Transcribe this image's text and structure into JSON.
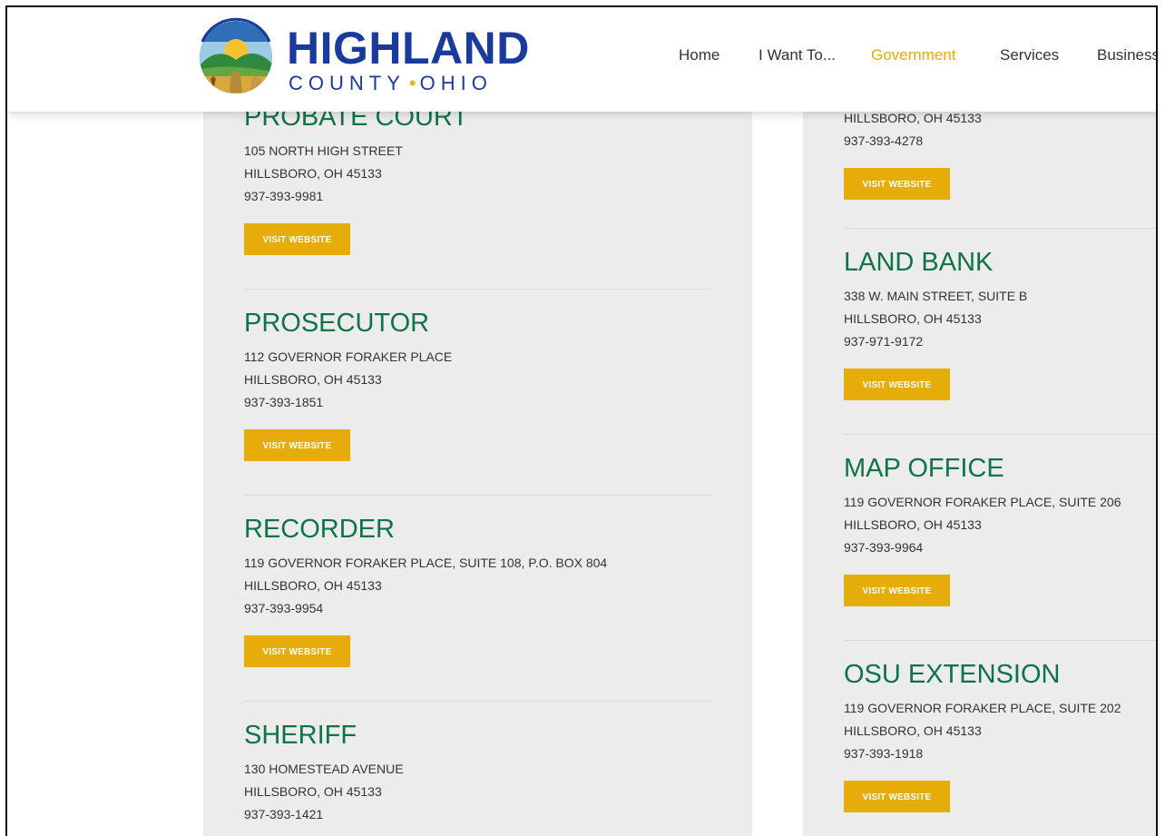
{
  "header": {
    "brand_main": "HIGHLAND",
    "brand_county": "COUNTY",
    "brand_state": "OHIO",
    "brand_separator": "•",
    "nav": [
      "Home",
      "I Want To...",
      "Government",
      "Services",
      "Business"
    ],
    "active_nav": "Government"
  },
  "button_label": "VISIT WEBSITE",
  "left_column": [
    {
      "name": "PROBATE COURT",
      "address": "105 NORTH HIGH STREET",
      "city": "HILLSBORO, OH 45133",
      "phone": "937-393-9981"
    },
    {
      "name": "PROSECUTOR",
      "address": "112 GOVERNOR FORAKER PLACE",
      "city": "HILLSBORO, OH 45133",
      "phone": "937-393-1851"
    },
    {
      "name": "RECORDER",
      "address": "119 GOVERNOR FORAKER PLACE, SUITE 108, P.O. BOX 804",
      "city": "HILLSBORO, OH 45133",
      "phone": "937-393-9954"
    },
    {
      "name": "SHERIFF",
      "address": "130 HOMESTEAD AVENUE",
      "city": "HILLSBORO, OH 45133",
      "phone": "937-393-1421"
    }
  ],
  "right_column": [
    {
      "name": "",
      "address": "",
      "city": "HILLSBORO, OH 45133",
      "phone": "937-393-4278"
    },
    {
      "name": "LAND BANK",
      "address": "338 W. MAIN STREET, SUITE B",
      "city": "HILLSBORO, OH 45133",
      "phone": "937-971-9172"
    },
    {
      "name": "MAP OFFICE",
      "address": "119 GOVERNOR FORAKER PLACE, SUITE 206",
      "city": "HILLSBORO, OH 45133",
      "phone": "937-393-9964"
    },
    {
      "name": "OSU EXTENSION",
      "address": "119 GOVERNOR FORAKER PLACE, SUITE 202",
      "city": "HILLSBORO, OH 45133",
      "phone": "937-393-1918"
    }
  ],
  "colors": {
    "heading_green": "#0f7347",
    "button_gold": "#e6ad0a",
    "brand_blue": "#1a3a9c",
    "nav_active": "#e3ab0a"
  }
}
